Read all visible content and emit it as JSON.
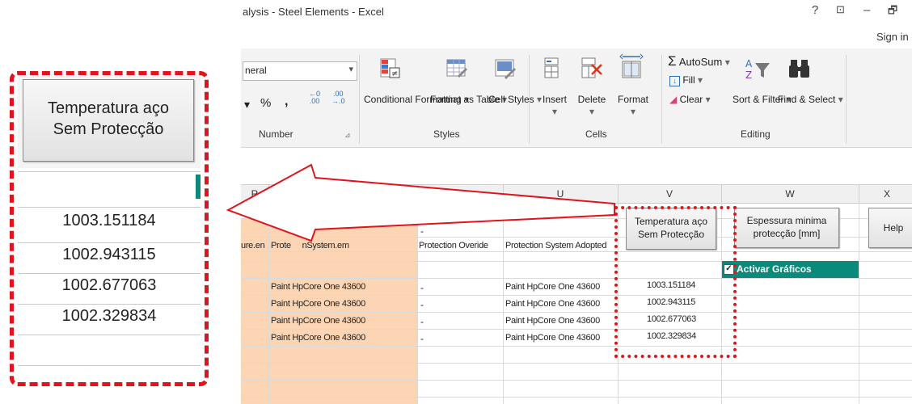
{
  "window": {
    "title": "alysis - Steel Elements - Excel",
    "sign_in": "Sign in",
    "controls": [
      "?",
      "⊡",
      "–",
      "🗗"
    ]
  },
  "ribbon": {
    "number_format": "neral",
    "percent": "%",
    "comma": ",",
    "number_group": "Number",
    "styles": {
      "conditional": "Conditional Formatting",
      "format_table": "Format as Table",
      "cell_styles": "Cell Styles",
      "group": "Styles"
    },
    "cells": {
      "insert": "Insert",
      "delete": "Delete",
      "format": "Format",
      "group": "Cells"
    },
    "editing": {
      "autosum": "AutoSum",
      "fill": "Fill",
      "clear": "Clear",
      "sort_filter": "Sort & Filter",
      "find_select": "Find & Select",
      "group": "Editing"
    }
  },
  "columns": [
    "R",
    "S",
    "T",
    "U",
    "V",
    "W",
    "X"
  ],
  "sheet": {
    "header_row": {
      "r": "ure.en",
      "s": "Prote     nSystem.em",
      "t": "Protection Overide",
      "u": "Protection System Adopted"
    },
    "t_dash": "-",
    "u_digit": "2",
    "rows": [
      {
        "s": "Paint HpCore One 43600",
        "t": "-",
        "u": "Paint HpCore One 43600",
        "v": "1003.151184"
      },
      {
        "s": "Paint HpCore One 43600",
        "t": "-",
        "u": "Paint HpCore One 43600",
        "v": "1002.943115"
      },
      {
        "s": "Paint HpCore One 43600",
        "t": "-",
        "u": "Paint HpCore One 43600",
        "v": "1002.677063"
      },
      {
        "s": "Paint HpCore One 43600",
        "t": "-",
        "u": "Paint HpCore One 43600",
        "v": "1002.329834"
      }
    ],
    "btn_temp_line1": "Temperatura aço",
    "btn_temp_line2": "Sem Protecção",
    "btn_esp_line1": "Espessura minima",
    "btn_esp_line2": "protecção [mm]",
    "btn_help": "Help",
    "activar_label": "Activar Gráficos"
  },
  "zoom": {
    "btn_line1": "Temperatura aço",
    "btn_line2": "Sem Protecção",
    "values": [
      "1003.151184",
      "1002.943115",
      "1002.677063",
      "1002.329834"
    ]
  },
  "colors": {
    "highlight": "#e0151b",
    "orange_fill": "#fcd5b4",
    "teal": "#0a8a7a"
  }
}
